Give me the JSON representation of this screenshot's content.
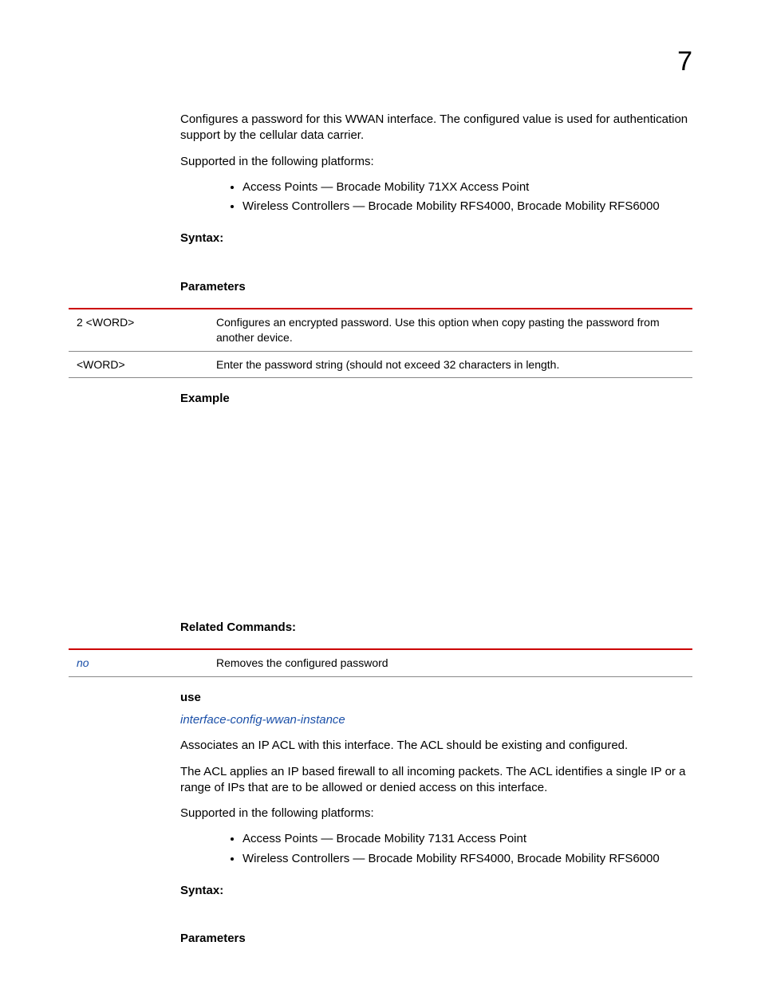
{
  "pageNumber": "7",
  "section1": {
    "intro1": "Configures a password for this WWAN interface. The configured value is used for authentication support by the cellular data carrier.",
    "supportedLabel": "Supported in the following platforms:",
    "bullets": [
      "Access Points — Brocade Mobility 71XX Access Point",
      "Wireless Controllers — Brocade Mobility RFS4000, Brocade Mobility RFS6000"
    ],
    "syntaxLabel": "Syntax:",
    "parametersLabel": "Parameters",
    "paramsTable": [
      {
        "c1": "2 <WORD>",
        "c2": "Configures an encrypted password. Use this option when copy pasting the password from another device."
      },
      {
        "c1": "<WORD>",
        "c2": "Enter the password string (should not exceed 32 characters in length."
      }
    ],
    "exampleLabel": "Example",
    "relatedLabel": "Related Commands:",
    "relatedTable": [
      {
        "c1": "no",
        "c2": "Removes the configured password"
      }
    ]
  },
  "section2": {
    "cmdName": "use",
    "link": "interface-config-wwan-instance",
    "intro1": "Associates an IP ACL with this interface. The ACL should be existing and configured.",
    "intro2": "The ACL applies an IP based firewall to all incoming packets. The ACL identifies a single IP or a range of IPs that are to be allowed or denied access on this interface.",
    "supportedLabel": "Supported in the following platforms:",
    "bullets": [
      "Access Points — Brocade Mobility 7131 Access Point",
      "Wireless Controllers — Brocade Mobility RFS4000, Brocade Mobility RFS6000"
    ],
    "syntaxLabel": "Syntax:",
    "parametersLabel": "Parameters"
  }
}
